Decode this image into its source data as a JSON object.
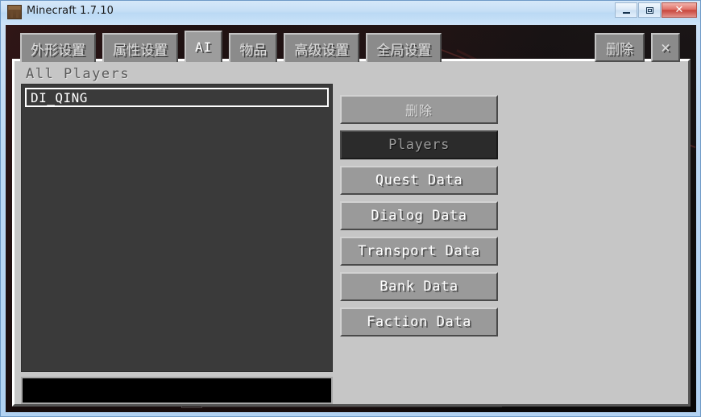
{
  "window": {
    "title": "Minecraft 1.7.10",
    "icon": "minecraft-block-icon",
    "minimize_label": "–",
    "maximize_label": "❐",
    "close_label": "✕"
  },
  "tabs": [
    {
      "label": "外形设置",
      "script": "cjk",
      "selected": false
    },
    {
      "label": "属性设置",
      "script": "cjk",
      "selected": false
    },
    {
      "label": "AI",
      "script": "latin",
      "selected": true
    },
    {
      "label": "物品",
      "script": "cjk",
      "selected": false
    },
    {
      "label": "高级设置",
      "script": "cjk",
      "selected": false
    },
    {
      "label": "全局设置",
      "script": "cjk",
      "selected": false
    }
  ],
  "top_right_buttons": [
    {
      "label": "删除",
      "name": "delete-button"
    },
    {
      "label": "✕",
      "name": "close-gui-button"
    }
  ],
  "panel": {
    "title": "All Players",
    "list": {
      "items": [
        {
          "label": "DI_QING",
          "selected": true
        }
      ]
    },
    "search": {
      "value": "",
      "placeholder": ""
    },
    "buttons": [
      {
        "label": "删除",
        "script": "cjk",
        "state": "disabled",
        "name": "panel-delete-button"
      },
      {
        "label": "Players",
        "script": "latin",
        "state": "active",
        "name": "players-button"
      },
      {
        "label": "Quest Data",
        "script": "latin",
        "state": "normal",
        "name": "quest-data-button"
      },
      {
        "label": "Dialog Data",
        "script": "latin",
        "state": "normal",
        "name": "dialog-data-button"
      },
      {
        "label": "Transport Data",
        "script": "latin",
        "state": "normal",
        "name": "transport-data-button"
      },
      {
        "label": "Bank Data",
        "script": "latin",
        "state": "normal",
        "name": "bank-data-button"
      },
      {
        "label": "Faction Data",
        "script": "latin",
        "state": "normal",
        "name": "faction-data-button"
      }
    ]
  },
  "colors": {
    "panel_bg": "#c6c6c6",
    "list_bg": "#3a3a3a",
    "button_bg": "#9a9a9a",
    "button_active_bg": "#2b2b2b",
    "input_bg": "#000000",
    "titlebar_accent": "#bcd8f4",
    "close_button": "#c8463c"
  }
}
